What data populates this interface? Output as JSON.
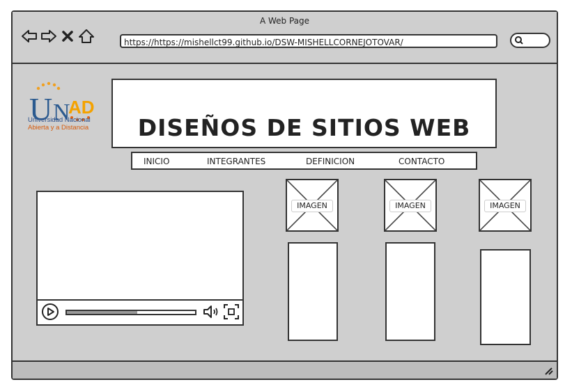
{
  "window": {
    "title": "A Web Page"
  },
  "browser": {
    "url": "https://https://mishellct99.github.io/DSW-MISHELLCORNEJOTOVAR/"
  },
  "logo": {
    "text": "UNAD",
    "line1": "Universidad Nacional",
    "line2": "Abierta y a Distancia"
  },
  "banner": {
    "title": "DISEÑOS DE SITIOS WEB"
  },
  "menu": {
    "items": [
      "INICIO",
      "INTEGRANTES",
      "DEFINICION",
      "CONTACTO"
    ]
  },
  "video": {
    "progress": 0.55
  },
  "images": [
    {
      "label": "IMAGEN"
    },
    {
      "label": "IMAGEN"
    },
    {
      "label": "IMAGEN"
    }
  ]
}
